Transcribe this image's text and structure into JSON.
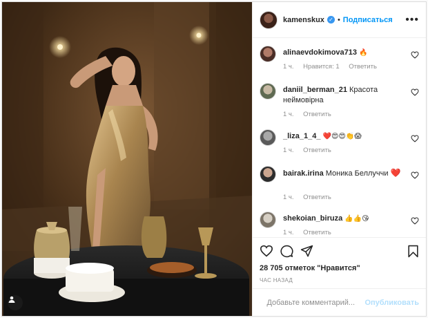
{
  "post": {
    "author": "kamenskux",
    "follow_label": "Подписаться",
    "dot": "•",
    "more_label": "•••"
  },
  "comments": [
    {
      "user": "alinaevdokimova713",
      "text": "",
      "emoji": "🔥",
      "time": "1 ч.",
      "likes_label": "Нравится: 1",
      "reply_label": "Ответить"
    },
    {
      "user": "daniil_berman_21",
      "text": "Красота неймовірна",
      "emoji": "",
      "time": "1 ч.",
      "likes_label": "",
      "reply_label": "Ответить"
    },
    {
      "user": "_liza_1_4_",
      "text": "",
      "emoji": "❤️😍😍👏😱",
      "time": "1 ч.",
      "likes_label": "",
      "reply_label": "Ответить"
    },
    {
      "user": "bairak.irina",
      "text": "Моника Беллуччи",
      "emoji": "❤️",
      "time": "1 ч.",
      "likes_label": "",
      "reply_label": "Ответить"
    },
    {
      "user": "shekoian_biruza",
      "text": "",
      "emoji": "👍👍😘",
      "time": "1 ч.",
      "likes_label": "",
      "reply_label": "Ответить"
    }
  ],
  "stats": {
    "likes_text": "28 705 отметок \"Нравится\"",
    "posted": "ЧАС НАЗАД"
  },
  "add_comment": {
    "placeholder": "Добавьте комментарий...",
    "publish_label": "Опубликовать"
  },
  "colors": {
    "accent": "#0095f6",
    "publish_disabled": "#b2dffc",
    "muted": "#8e8e8e"
  }
}
